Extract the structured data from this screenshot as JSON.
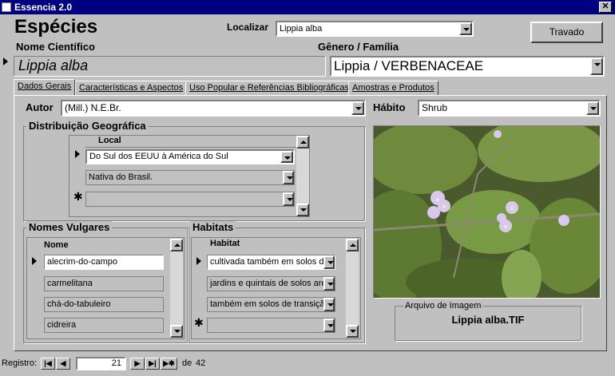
{
  "window": {
    "title": "Essencia 2.0"
  },
  "header": {
    "title": "Espécies",
    "scientific_name_label": "Nome Científico",
    "genus_family_label": "Gênero / Família",
    "search_label": "Localizar",
    "search_value": "Lippia alba",
    "lock_button": "Travado"
  },
  "record": {
    "scientific_name": "Lippia alba",
    "genus_family": "Lippia / VERBENACEAE"
  },
  "tabs": [
    {
      "label": "Dados Gerais",
      "active": true
    },
    {
      "label": "Características e Aspectos"
    },
    {
      "label": "Uso Popular e Referências Bibliográficas"
    },
    {
      "label": "Amostras e Produtos"
    }
  ],
  "general": {
    "author_label": "Autor",
    "author_value": "(Mill.) N.E.Br.",
    "habit_label": "Hábito",
    "habit_value": "Shrub"
  },
  "distribution": {
    "title": "Distribuição Geográfica",
    "column": "Local",
    "rows": [
      "Do Sul dos EEUU à América do Sul",
      "Nativa do Brasil."
    ]
  },
  "common_names": {
    "title": "Nomes Vulgares",
    "column": "Nome",
    "rows": [
      "alecrim-do-campo",
      "carmelitana",
      "chá-do-tabuleiro",
      "cidreira"
    ]
  },
  "habitats": {
    "title": "Habitats",
    "column": "Habitat",
    "rows": [
      "cultivada também em solos de",
      "jardins e quintais de solos are",
      "também em solos de transição",
      ""
    ]
  },
  "image": {
    "label": "Arquivo de Imagem",
    "filename": "Lippia alba.TIF"
  },
  "navigation": {
    "label": "Registro:",
    "current": "21",
    "of_label": "de",
    "total": "42"
  },
  "colors": {
    "titlebar": "#000080",
    "face": "#c0c0c0"
  }
}
